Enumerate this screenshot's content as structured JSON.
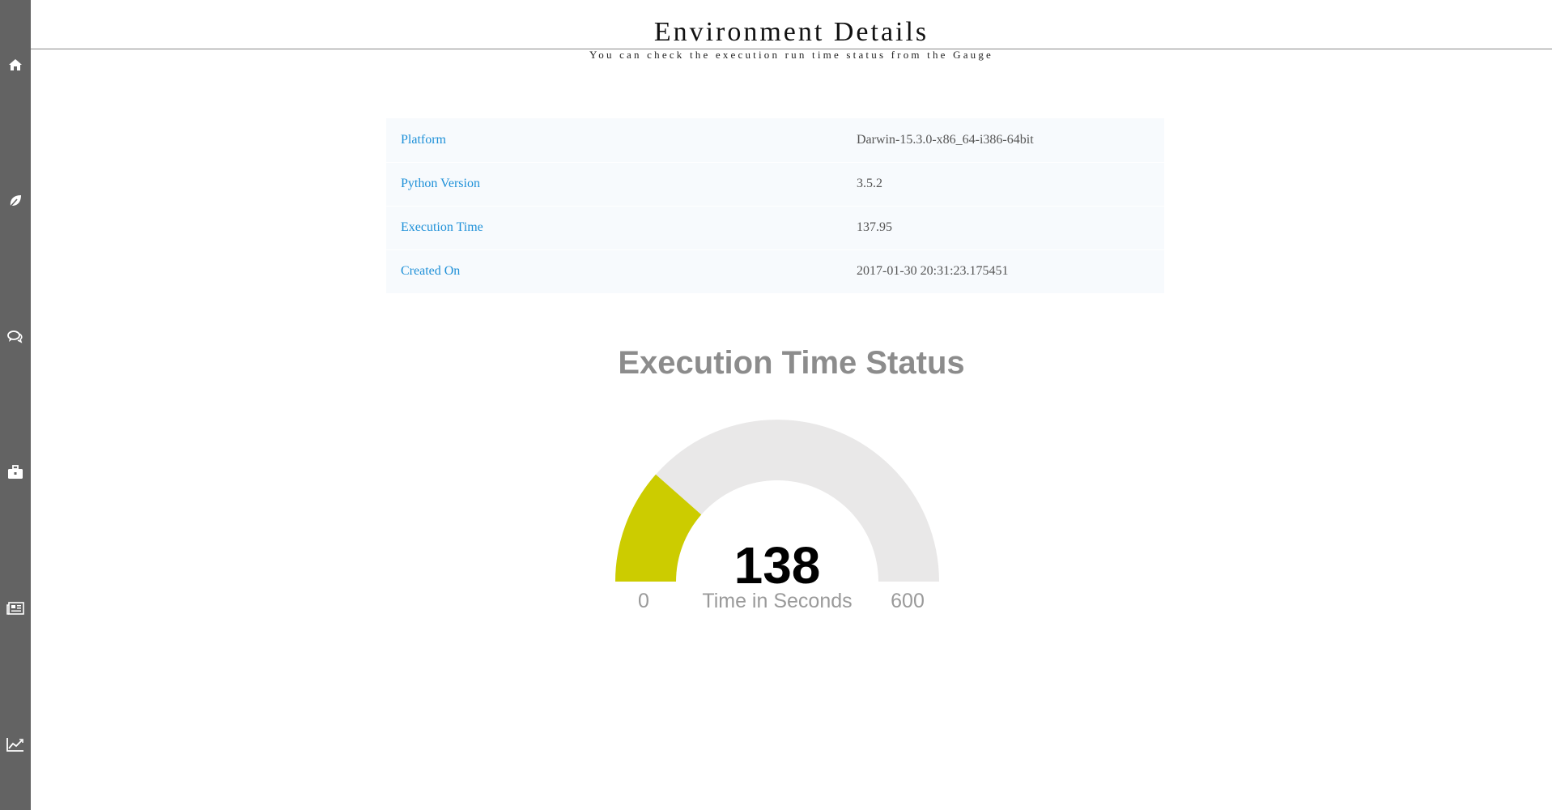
{
  "header": {
    "title": "Environment Details",
    "subtitle": "You can check the execution run time status from the Gauge"
  },
  "sidebar": {
    "items": [
      {
        "icon": "home-icon"
      },
      {
        "icon": "leaf-icon"
      },
      {
        "icon": "comments-icon"
      },
      {
        "icon": "briefcase-icon"
      },
      {
        "icon": "newspaper-icon"
      },
      {
        "icon": "line-chart-icon"
      }
    ]
  },
  "environment": {
    "rows": [
      {
        "key": "Platform",
        "value": "Darwin-15.3.0-x86_64-i386-64bit"
      },
      {
        "key": "Python Version",
        "value": "3.5.2"
      },
      {
        "key": "Execution Time",
        "value": "137.95"
      },
      {
        "key": "Created On",
        "value": "2017-01-30 20:31:23.175451"
      }
    ]
  },
  "gauge": {
    "title": "Execution Time Status",
    "value_label": "138",
    "unit_label": "Time in Seconds",
    "min_label": "0",
    "max_label": "600",
    "value": 137.95,
    "min": 0,
    "max": 600,
    "fill_color": "#cccc00",
    "track_color": "#e9e8e8"
  },
  "colors": {
    "sidebar_bg": "#636363",
    "key_text": "#1e90d8",
    "value_text": "#555555",
    "row_bg": "#f7fafd"
  }
}
